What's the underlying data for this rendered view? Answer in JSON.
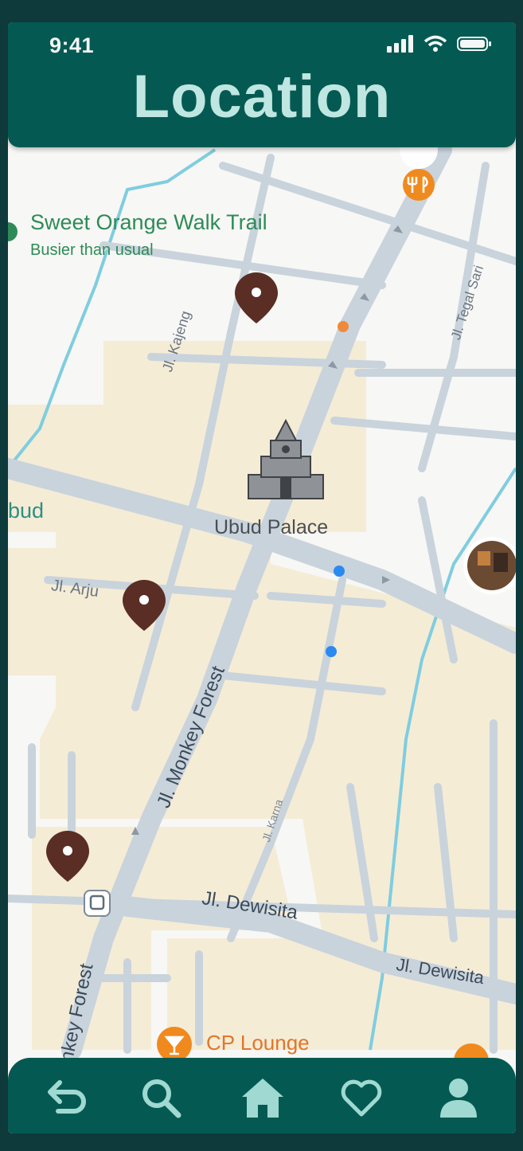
{
  "status_bar": {
    "time": "9:41"
  },
  "header": {
    "title": "Location"
  },
  "map": {
    "places": {
      "trail_name": "Sweet Orange Walk Trail",
      "trail_status": "Busier than usual",
      "palace": "Ubud Palace",
      "ubud_partial": "bud",
      "lounge": "CP Lounge"
    },
    "streets": {
      "kajeng": "Jl. Kajeng",
      "tegal_sari": "Jl. Tegal Sari",
      "arjuna_partial": "Jl. Arju",
      "monkey_forest": "Jl. Monkey Forest",
      "monkey_forest_lower": "nkey Forest",
      "karna": "Jl. Karna",
      "dewisita": "Jl. Dewisita",
      "dewisita_east": "Jl. Dewisita"
    }
  },
  "bottom_nav": [
    {
      "icon": "back-icon"
    },
    {
      "icon": "search-icon"
    },
    {
      "icon": "home-icon"
    },
    {
      "icon": "heart-icon"
    },
    {
      "icon": "profile-icon"
    }
  ],
  "colors": {
    "header": "#045a52",
    "title": "#bfe6e1",
    "nav_icon": "#9fd9d1",
    "pin": "#5a2e24",
    "trail_text": "#2e8b57",
    "lounge_text": "#e0762b",
    "road": "#c9d3dc",
    "block": "#f5ecd6",
    "water": "#7fcde0"
  }
}
